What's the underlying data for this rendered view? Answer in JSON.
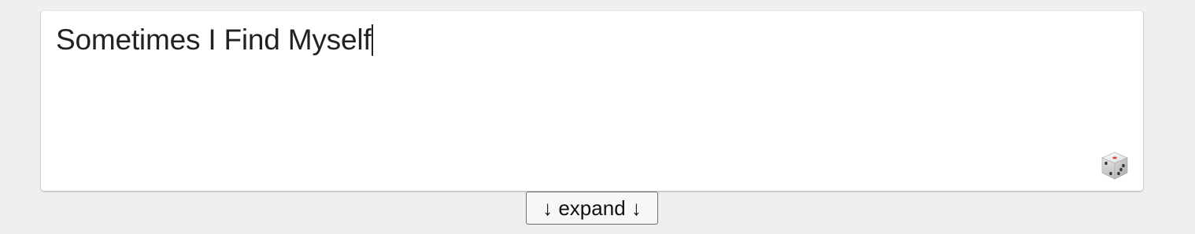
{
  "editor": {
    "text": "Sometimes I Find Myself",
    "dice_icon": "dice-icon"
  },
  "expand_button": {
    "label": "↓ expand ↓"
  },
  "colors": {
    "page_background": "#efefef",
    "card_background": "#ffffff",
    "text": "#222222",
    "dice_pip_red": "#e0413a"
  }
}
